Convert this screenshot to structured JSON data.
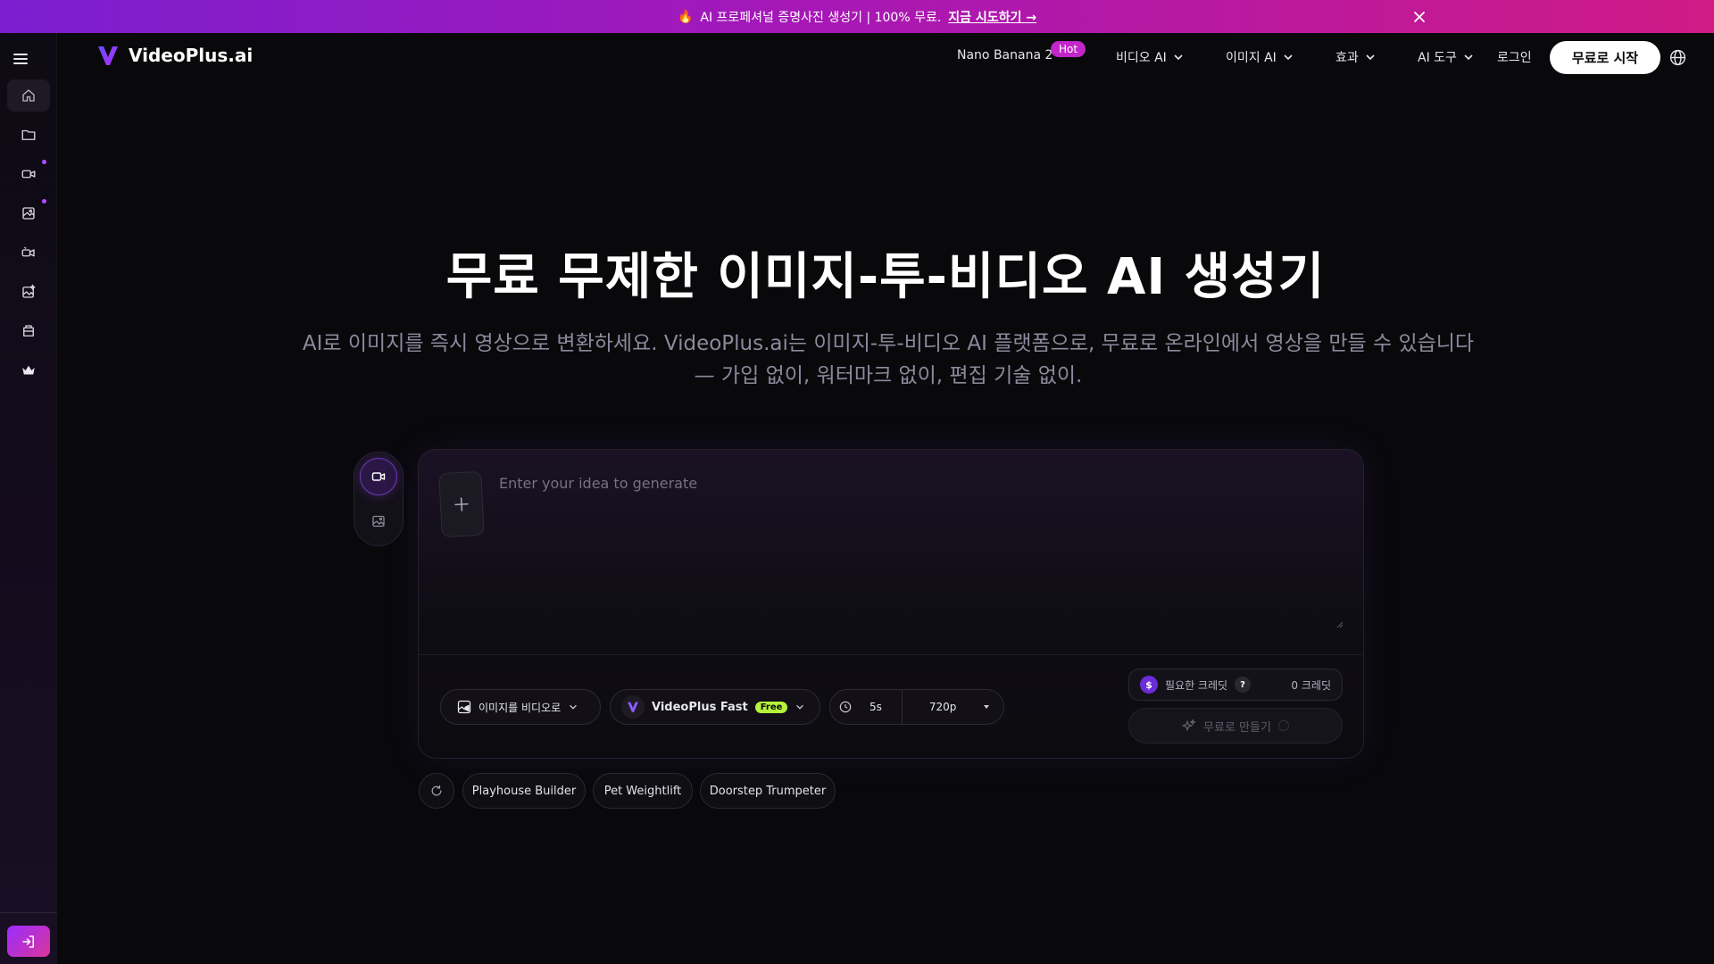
{
  "promo": {
    "emoji": "🔥",
    "text": "AI 프로페셔널 증명사진 생성기 | 100% 무료.",
    "cta": "지금 시도하기 →"
  },
  "header": {
    "logo_text": "VideoPlus.ai",
    "nav": {
      "nano": "Nano Banana 2",
      "hot": "Hot",
      "video_ai": "비디오 AI",
      "image_ai": "이미지 AI",
      "effects": "효과",
      "ai_tools": "AI 도구",
      "login": "로그인"
    },
    "start_button": "무료로 시작"
  },
  "hero": {
    "title": "무료 무제한 이미지-투-비디오 AI 생성기",
    "subtitle": "AI로 이미지를 즉시 영상으로 변환하세요. VideoPlus.ai는 이미지-투-비디오 AI 플랫폼으로, 무료로 온라인에서 영상을 만들 수 있습니다 — 가입 없이, 워터마크 없이, 편집 기술 없이."
  },
  "generator": {
    "placeholder": "Enter your idea to generate",
    "prompt_value": "",
    "mode_label": "이미지를 비디오로",
    "model_name": "VideoPlus Fast",
    "model_badge": "Free",
    "duration": "5s",
    "resolution": "720p",
    "credits_label": "필요한 크레딧",
    "help_mark": "?",
    "credits_value": "0 크레딧",
    "coin_symbol": "$",
    "create_label": "무료로 만들기"
  },
  "suggestions": [
    "Playhouse Builder",
    "Pet Weightlift",
    "Doorstep Trumpeter"
  ],
  "colors": {
    "accent_purple": "#9b2cff",
    "accent_pink": "#d9369a",
    "hot_badge": "#c226c9",
    "free_badge": "#b6f23a",
    "background": "#09090c"
  },
  "sidebar_icons": [
    "home-icon",
    "folder-icon",
    "video-ai-icon",
    "image-ai-icon",
    "video-effects-icon",
    "image-effects-icon",
    "ai-tools-icon",
    "crown-icon"
  ]
}
